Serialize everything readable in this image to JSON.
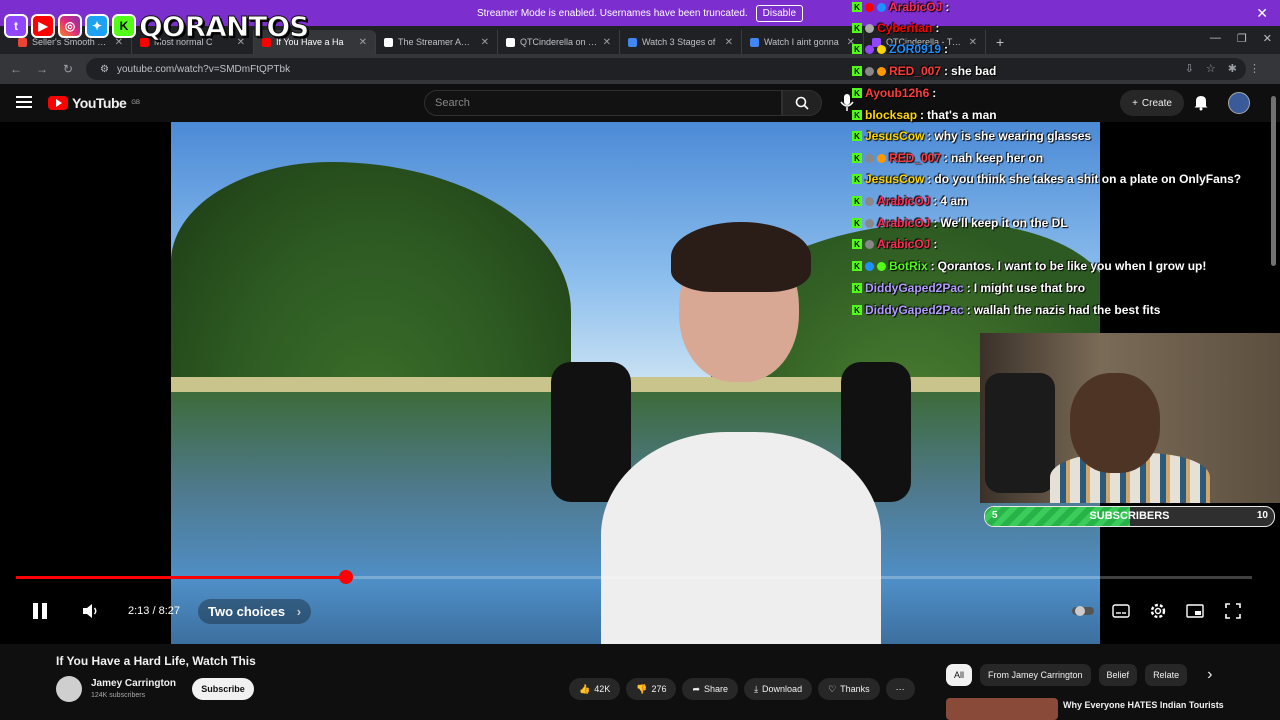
{
  "banner": {
    "text": "Streamer Mode is enabled. Usernames have been truncated.",
    "disable_label": "Disable"
  },
  "tabs": [
    {
      "label": "Seller's Smooth Bow...",
      "color": "#ea4335"
    },
    {
      "label": "Most normal C",
      "color": "#ff0000"
    },
    {
      "label": "If You Have a Ha",
      "color": "#ff0000",
      "active": true
    },
    {
      "label": "The Streamer Award",
      "color": "#ffffff"
    },
    {
      "label": "QTCinderella on X: \"",
      "color": "#ffffff"
    },
    {
      "label": "Watch 3 Stages of",
      "color": "#4285f4"
    },
    {
      "label": "Watch I aint gonna",
      "color": "#4285f4"
    },
    {
      "label": "QTCinderella - Twitch",
      "color": "#9146ff"
    }
  ],
  "address": {
    "url": "youtube.com/watch?v=SMDmFtQPTbk"
  },
  "overlay": {
    "streamer_name": "QORANTOS"
  },
  "youtube": {
    "logo": "YouTube",
    "country": "GB",
    "search_placeholder": "Search",
    "create_label": "Create"
  },
  "chat": [
    {
      "user": "ArabicOJ",
      "msg": "",
      "color": "#ff2d55",
      "badges": [
        "#ff0000",
        "#1e90ff"
      ]
    },
    {
      "user": "Cyberitan",
      "msg": "",
      "color": "#ff0000",
      "badges": [
        "#aaaaaa"
      ]
    },
    {
      "user": "ZOR0919",
      "msg": "",
      "color": "#1e90ff",
      "badges": [
        "#9146ff",
        "#ffd700"
      ]
    },
    {
      "user": "RED_007",
      "msg": "she bad",
      "color": "#ff3b3b",
      "badges": [
        "#888888",
        "#ff9900"
      ]
    },
    {
      "user": "Ayoub12h6",
      "msg": "",
      "color": "#ff3b3b",
      "badges": []
    },
    {
      "user": "blocksap",
      "msg": "that's a man",
      "color": "#ffd700",
      "badges": []
    },
    {
      "user": "JesusCow",
      "msg": "why is she wearing glasses",
      "color": "#ffd700",
      "badges": []
    },
    {
      "user": "RED_007",
      "msg": "nah keep her on",
      "color": "#ff3b3b",
      "badges": [
        "#888888",
        "#ff9900"
      ]
    },
    {
      "user": "JesusCow",
      "msg": "do you think she takes a shit on a plate on OnlyFans?",
      "color": "#ffd700",
      "badges": []
    },
    {
      "user": "ArabicOJ",
      "msg": "4 am",
      "color": "#ff2d55",
      "badges": [
        "#888888"
      ]
    },
    {
      "user": "ArabicOJ",
      "msg": "We'll keep it on the DL",
      "color": "#ff2d55",
      "badges": [
        "#888888"
      ]
    },
    {
      "user": "ArabicOJ",
      "msg": "",
      "color": "#ff2d55",
      "badges": [
        "#888888"
      ]
    },
    {
      "user": "BotRix",
      "msg": "Qorantos. I want to be like you when I grow up!",
      "color": "#53fc18",
      "badges": [
        "#1e90ff",
        "#53fc18"
      ]
    },
    {
      "user": "DiddyGaped2Pac",
      "msg": "I might use that bro",
      "color": "#b19cff",
      "badges": []
    },
    {
      "user": "DiddyGaped2Pac",
      "msg": "wallah the nazis had the best fits",
      "color": "#b19cff",
      "badges": []
    }
  ],
  "subgoal": {
    "label": "SUBSCRIBERS",
    "current": "5",
    "goal": "10",
    "progress": 0.5
  },
  "player": {
    "time": "2:13 / 8:27",
    "chapter": "Two choices",
    "progress": 0.267
  },
  "video": {
    "title": "If You Have a Hard Life, Watch This",
    "channel": "Jamey Carrington",
    "subscribers": "124K subscribers",
    "subscribe_label": "Subscribe",
    "likes": "42K",
    "dislikes": "276",
    "share": "Share",
    "download": "Download",
    "thanks": "Thanks"
  },
  "chips": [
    "All",
    "From Jamey Carrington",
    "Belief",
    "Relate"
  ],
  "recommended": {
    "title": "Why Everyone HATES Indian Tourists"
  }
}
